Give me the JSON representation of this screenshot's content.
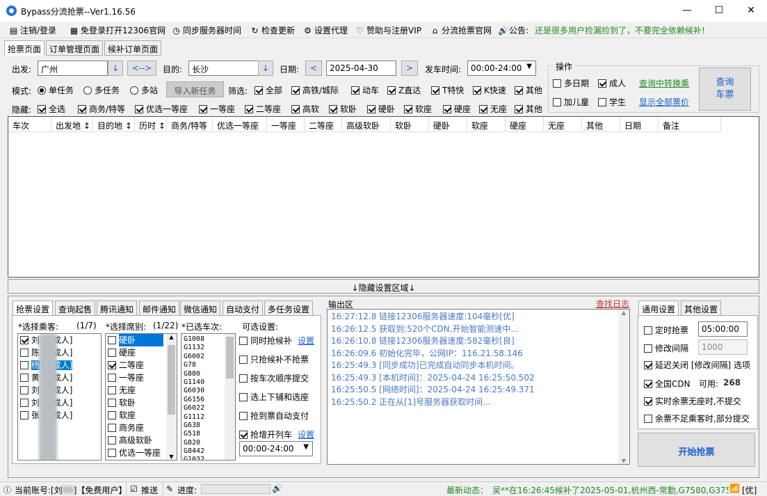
{
  "window": {
    "title": "Bypass分流抢票--Ver1.16.56",
    "minimize": "—",
    "maximize": "☐",
    "close": "✕"
  },
  "menu": [
    {
      "icon": "▤",
      "label": "注销/登录"
    },
    {
      "icon": "▦",
      "label": "免登录打开12306官网"
    },
    {
      "icon": "◷",
      "label": "同步服务器时间"
    },
    {
      "icon": "↻",
      "label": "检查更新"
    },
    {
      "icon": "⚙",
      "label": "设置代理"
    },
    {
      "icon": "♡",
      "label": "赞助与注册VIP"
    },
    {
      "icon": "⌂",
      "label": "分流抢票官网"
    },
    {
      "icon": "🔊",
      "label": "公告:"
    }
  ],
  "notice": "还是很多用户捡漏捡到了，不要完全依赖候补!",
  "tabs": [
    "抢票页面",
    "订单管理页面",
    "候补订单页面"
  ],
  "query": {
    "from_label": "出发:",
    "from_value": "广州",
    "swap": "<-->",
    "to_label": "目的:",
    "to_value": "长沙",
    "date_label": "日期:",
    "date_value": "2025-04-30",
    "prev": "<",
    "next": ">",
    "time_label": "发车时间:",
    "time_value": "00:00-24:00",
    "dropdown_arrow": "↓",
    "mode_label": "模式:",
    "modes": [
      "单任务",
      "多任务",
      "多站"
    ],
    "import_btn": "导入新任务",
    "filter_label": "筛选:",
    "filters": [
      "全部",
      "高铁/城际",
      "动车",
      "Z直达",
      "T特快",
      "K快速",
      "其他"
    ],
    "hide_label": "隐藏:",
    "hides": [
      "全选",
      "商务/特等",
      "优选一等座",
      "一等座",
      "二等座",
      "高软",
      "软卧",
      "硬卧",
      "软座",
      "硬座",
      "无座",
      "其他"
    ]
  },
  "ops": {
    "title": "操作",
    "options": [
      "多日期",
      "成人",
      "加儿童",
      "学生"
    ],
    "link1": "查询中转换乘",
    "link2": "显示全部票价",
    "query_btn": "查询车票"
  },
  "table_headers": [
    "车次",
    "出发地 ↕",
    "目的地 ↕",
    "历时 ↕",
    "商务/特等",
    "优选一等座",
    "一等座",
    "二等座",
    "高级软卧",
    "软卧",
    "硬卧",
    "软座",
    "硬座",
    "无座",
    "其他",
    "日期",
    "备注"
  ],
  "hide_area": "↓隐藏设置区域↓",
  "left_tabs": [
    "抢票设置",
    "查询起售",
    "腾讯通知",
    "邮件通知",
    "微信通知",
    "自动支付",
    "多任务设置"
  ],
  "passengers": {
    "label": "*选择乘客:",
    "count": "(1/7)",
    "items": [
      {
        "name": "刘",
        "suffix": "[成人]",
        "checked": true
      },
      {
        "name": "陈",
        "suffix": "[成人]",
        "checked": false
      },
      {
        "name": "杨",
        "suffix": "[成人]",
        "checked": false
      },
      {
        "name": "黄",
        "suffix": "[成人]",
        "checked": false
      },
      {
        "name": "刘",
        "suffix": "[成人]",
        "checked": false
      },
      {
        "name": "刘",
        "suffix": "[成人]",
        "checked": false
      },
      {
        "name": "张",
        "suffix": "[成人]",
        "checked": false
      }
    ]
  },
  "seats": {
    "label": "*选择席别:",
    "count": "(1/22)",
    "items": [
      {
        "name": "硬卧",
        "checked": false
      },
      {
        "name": "硬座",
        "checked": false
      },
      {
        "name": "二等座",
        "checked": true
      },
      {
        "name": "一等座",
        "checked": false
      },
      {
        "name": "无座",
        "checked": false
      },
      {
        "name": "软卧",
        "checked": false
      },
      {
        "name": "软座",
        "checked": false
      },
      {
        "name": "商务座",
        "checked": false
      },
      {
        "name": "高级软卧",
        "checked": false
      },
      {
        "name": "优选一等座",
        "checked": false
      }
    ]
  },
  "trains": {
    "label": "*已选车次:",
    "items": [
      "G1008",
      "G1132",
      "G6002",
      "G78",
      "G880",
      "G1140",
      "G6030",
      "G6156",
      "G6022",
      "G1112",
      "G638",
      "G518",
      "G820",
      "G8442",
      "G1032"
    ]
  },
  "optional": {
    "label": "可选设置:",
    "items": [
      {
        "label": "同时抢候补",
        "checked": false,
        "link": "设置"
      },
      {
        "label": "只抢候补不抢票",
        "checked": false
      },
      {
        "label": "按车次顺序提交",
        "checked": false
      },
      {
        "label": "选上下铺和选座",
        "checked": false
      },
      {
        "label": "抢到票自动支付",
        "checked": false
      },
      {
        "label": "抢增开列车",
        "checked": true,
        "link": "设置"
      }
    ],
    "time_value": "00:00-24:00"
  },
  "log": {
    "label": "输出区",
    "link": "查找日志",
    "lines": [
      "16:27:12.8  链接12306服务器速度:104毫秒[优]",
      "16:26:12.5  获取到:520个CDN,开始智能测速中...",
      "16:26:10.8  链接12306服务器速度:582毫秒[良]",
      "16:26:09.6  初始化完毕，公网IP：116.21.58.146",
      "16:25:49.3  [同步成功]已完成自动同步本机时间。",
      "16:25:49.3  [本机时间]：2025-04-24 16:25:50.502",
      "16:25:50.5  [网络时间]：2025-04-24 16:25:49.371",
      "16:25:50.2  正在从[1]号服务器获取时间..."
    ]
  },
  "right_tabs": [
    "通用设置",
    "其他设置"
  ],
  "general": {
    "timed": "定时抢票",
    "timed_value": "05:00:00",
    "interval": "修改间隔",
    "interval_value": "1000",
    "delay": "延迟关闭 [修改间隔] 选项",
    "cdn": "全国CDN",
    "cdn_avail_label": "可用:",
    "cdn_avail": "268",
    "realtime": "实时余票无座时,不提交",
    "partial": "余票不足乘客时,部分提交",
    "start_btn": "开始抢票"
  },
  "status": {
    "account": "当前账号:[刘",
    "account_tail": "]【免费用户】",
    "push": "推送",
    "progress": "进度:",
    "news_label": "最新动态：",
    "news": "吴**在16:26:45候补了2025-05-01,杭州西-常勤,G7580,G3754",
    "quality": "[优]"
  },
  "colors": {
    "accent": "#1a5fd0",
    "green": "#1f8a1f",
    "select": "#0078d7"
  }
}
